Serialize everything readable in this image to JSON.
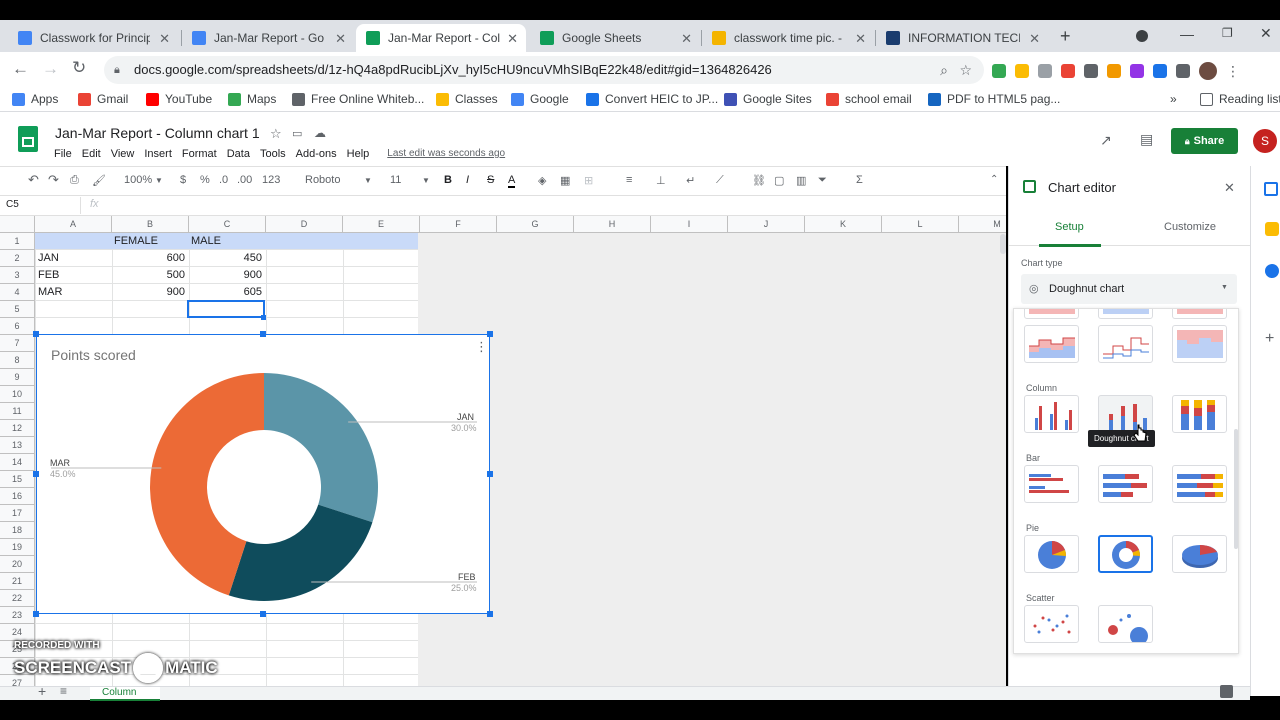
{
  "browser": {
    "tabs": [
      {
        "title": "Classwork for Principle",
        "color": "#4285f4"
      },
      {
        "title": "Jan-Mar Report - Goo",
        "color": "#4285f4"
      },
      {
        "title": "Jan-Mar Report - Colu",
        "color": "#0f9d58"
      },
      {
        "title": "Google Sheets",
        "color": "#0f9d58"
      },
      {
        "title": "classwork time pic. - G",
        "color": "#f4b400"
      },
      {
        "title": "INFORMATION TECHN",
        "color": "#1a3c6e"
      }
    ],
    "url": "docs.google.com/spreadsheets/d/1z-hQ4a8pdRucibLjXv_hyI5cHU9ncuVMhSIBqE22k48/edit#gid=1364826426",
    "bookmarks": [
      {
        "label": "Apps",
        "color": "#4285f4"
      },
      {
        "label": "Gmail",
        "color": "#ea4335"
      },
      {
        "label": "YouTube",
        "color": "#ff0000"
      },
      {
        "label": "Maps",
        "color": "#34a853"
      },
      {
        "label": "Free Online Whiteb...",
        "color": "#5f6368"
      },
      {
        "label": "Classes",
        "color": "#fbbc04"
      },
      {
        "label": "Google",
        "color": "#4285f4"
      },
      {
        "label": "Convert HEIC to JP...",
        "color": "#1a73e8"
      },
      {
        "label": "Google Sites",
        "color": "#3f51b5"
      },
      {
        "label": "school email",
        "color": "#ea4335"
      },
      {
        "label": "PDF to HTML5 pag...",
        "color": "#1565c0"
      }
    ],
    "reading_list": "Reading list"
  },
  "doc": {
    "title": "Jan-Mar Report - Column chart 1",
    "menu": [
      "File",
      "Edit",
      "View",
      "Insert",
      "Format",
      "Data",
      "Tools",
      "Add-ons",
      "Help"
    ],
    "last_edit": "Last edit was seconds ago",
    "share": "Share",
    "avatar": "S"
  },
  "toolbar": {
    "zoom": "100%",
    "currency": "$",
    "percent": "%",
    "dec1": ".0",
    "dec2": ".00",
    "format": "123",
    "font": "Roboto",
    "size": "11"
  },
  "formula": {
    "cell_ref": "C5",
    "fx": "fx"
  },
  "grid": {
    "columns": [
      "A",
      "B",
      "C",
      "D",
      "E",
      "F",
      "G",
      "H",
      "I",
      "J",
      "K",
      "L",
      "M"
    ],
    "rows": [
      "1",
      "2",
      "3",
      "4",
      "5",
      "6",
      "7",
      "8",
      "9",
      "10",
      "11",
      "12",
      "13",
      "14",
      "15",
      "16",
      "17",
      "18",
      "19",
      "20",
      "21",
      "22",
      "23",
      "24",
      "25",
      "26",
      "27"
    ],
    "header": {
      "b": "FEMALE",
      "c": "MALE"
    },
    "data": [
      {
        "month": "JAN",
        "female": "600",
        "male": "450"
      },
      {
        "month": "FEB",
        "female": "500",
        "male": "900"
      },
      {
        "month": "MAR",
        "female": "900",
        "male": "605"
      }
    ]
  },
  "chart": {
    "title": "Points scored",
    "labels": [
      {
        "name": "JAN",
        "pct": "30.0%"
      },
      {
        "name": "FEB",
        "pct": "25.0%"
      },
      {
        "name": "MAR",
        "pct": "45.0%"
      }
    ]
  },
  "chart_data": {
    "type": "pie",
    "title": "Points scored",
    "categories": [
      "JAN",
      "FEB",
      "MAR"
    ],
    "values": [
      30.0,
      25.0,
      45.0
    ],
    "colors": [
      "#5b95a8",
      "#0f4c5c",
      "#ec6a36"
    ],
    "hole": 0.5
  },
  "editor": {
    "title": "Chart editor",
    "tabs": [
      "Setup",
      "Customize"
    ],
    "chart_type_label": "Chart type",
    "chart_type_value": "Doughnut chart",
    "sections": [
      "Column",
      "Bar",
      "Pie",
      "Scatter"
    ],
    "tooltip": "Doughnut chart"
  },
  "sheet_tab": "Column",
  "watermark": {
    "line1": "RECORDED WITH",
    "line2": "SCREENCAST",
    "line3": "MATIC"
  }
}
